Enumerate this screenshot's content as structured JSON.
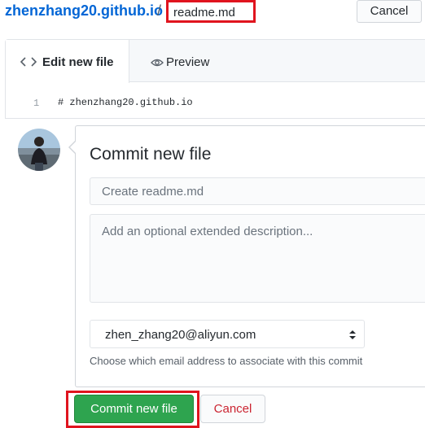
{
  "breadcrumb": {
    "repo": "zhenzhang20.github.io",
    "separator": "/"
  },
  "filename": {
    "value": "readme.md"
  },
  "header": {
    "cancel_label": "Cancel"
  },
  "editor": {
    "tabs": [
      {
        "label": "Edit new file",
        "icon": "code-icon",
        "active": true
      },
      {
        "label": "Preview",
        "icon": "eye-icon",
        "active": false
      }
    ],
    "lines": [
      {
        "number": "1",
        "text": "# zhenzhang20.github.io"
      }
    ]
  },
  "commit": {
    "title": "Commit new file",
    "summary_placeholder": "Create readme.md",
    "description_placeholder": "Add an optional extended description...",
    "email_selected": "zhen_zhang20@aliyun.com",
    "email_note": "Choose which email address to associate with this commit",
    "commit_label": "Commit new file",
    "cancel_label": "Cancel"
  },
  "colors": {
    "accent": "#0366d6",
    "commit_green": "#2ea44f",
    "cancel_red": "#cb2431",
    "highlight": "#e0141e"
  }
}
